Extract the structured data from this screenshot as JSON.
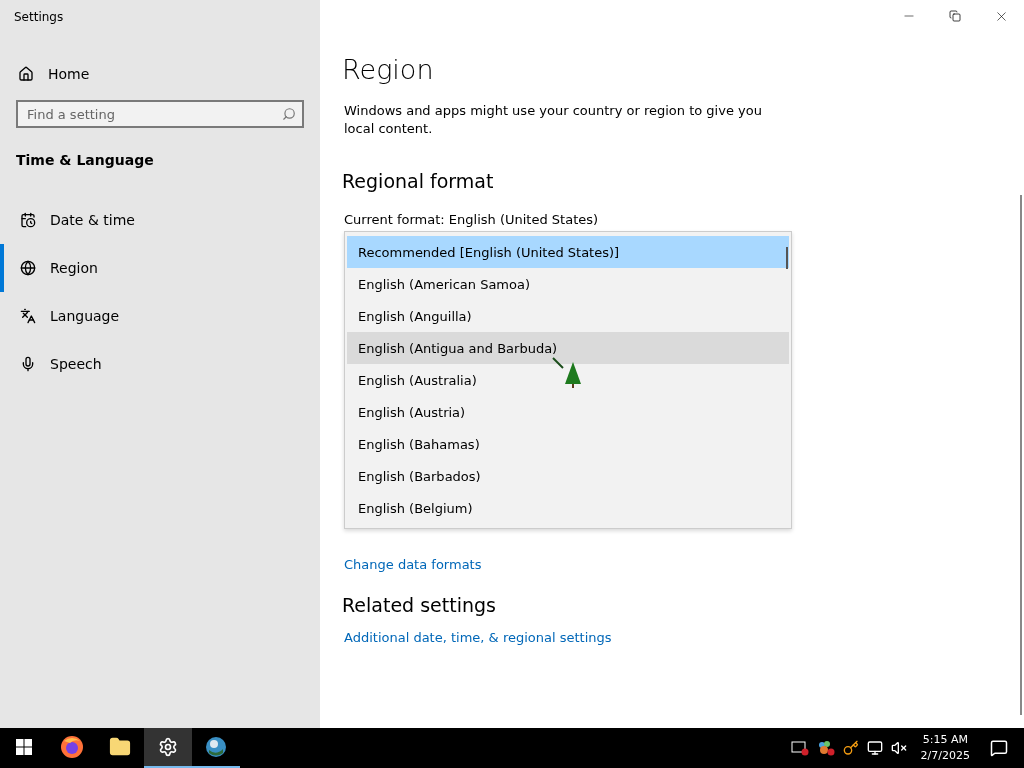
{
  "window": {
    "title": "Settings"
  },
  "sidebar": {
    "home": "Home",
    "search": {
      "placeholder": "Find a setting"
    },
    "section": "Time & Language",
    "items": [
      {
        "label": "Date & time",
        "kind": "calendar",
        "selected": false
      },
      {
        "label": "Region",
        "kind": "globe",
        "selected": true
      },
      {
        "label": "Language",
        "kind": "language",
        "selected": false
      },
      {
        "label": "Speech",
        "kind": "microphone",
        "selected": false
      }
    ]
  },
  "main": {
    "title": "Region",
    "description": "Windows and apps might use your country or region to give you local content.",
    "regional_format": {
      "heading": "Regional format",
      "current": "Current format: English (United States)",
      "dropdown": {
        "expanded": true,
        "options": [
          {
            "label": "Recommended [English (United States)]",
            "selected": true,
            "hovered": false
          },
          {
            "label": "English (American Samoa)",
            "selected": false,
            "hovered": false
          },
          {
            "label": "English (Anguilla)",
            "selected": false,
            "hovered": false
          },
          {
            "label": "English (Antigua and Barbuda)",
            "selected": false,
            "hovered": true
          },
          {
            "label": "English (Australia)",
            "selected": false,
            "hovered": false
          },
          {
            "label": "English (Austria)",
            "selected": false,
            "hovered": false
          },
          {
            "label": "English (Bahamas)",
            "selected": false,
            "hovered": false
          },
          {
            "label": "English (Barbados)",
            "selected": false,
            "hovered": false
          },
          {
            "label": "English (Belgium)",
            "selected": false,
            "hovered": false
          }
        ]
      }
    },
    "change_link": "Change data formats",
    "related": {
      "heading": "Related settings",
      "link": "Additional date, time, & regional settings"
    }
  },
  "taskbar": {
    "apps": [
      {
        "kind": "start",
        "selected": false,
        "running": false
      },
      {
        "kind": "firefox",
        "selected": false,
        "running": false
      },
      {
        "kind": "folder",
        "selected": false,
        "running": false
      },
      {
        "kind": "gear",
        "selected": true,
        "running": true
      },
      {
        "kind": "globe",
        "selected": false,
        "running": true
      }
    ],
    "time": "5:15 AM",
    "date": "2/7/2025"
  }
}
